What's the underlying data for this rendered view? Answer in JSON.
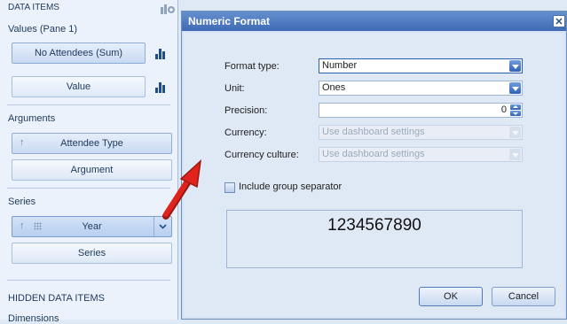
{
  "left_panel": {
    "header": "DATA ITEMS",
    "values_section": "Values (Pane 1)",
    "values_items": [
      "No Attendees (Sum)",
      "Value"
    ],
    "arguments_section": "Arguments",
    "arguments_items": [
      "Attendee Type",
      "Argument"
    ],
    "series_section": "Series",
    "series_items": [
      "Year",
      "Series"
    ],
    "hidden_section": "HIDDEN DATA ITEMS",
    "hidden_partial": "Dimensions"
  },
  "dialog": {
    "title": "Numeric Format",
    "close_glyph": "✕",
    "fields": {
      "format_type": {
        "label": "Format type:",
        "value": "Number"
      },
      "unit": {
        "label": "Unit:",
        "value": "Ones"
      },
      "precision": {
        "label": "Precision:",
        "value": "0"
      },
      "currency": {
        "label": "Currency:",
        "value": "Use dashboard settings"
      },
      "currency_culture": {
        "label": "Currency culture:",
        "value": "Use dashboard settings"
      }
    },
    "group_separator_label": "Include group separator",
    "group_separator_checked": false,
    "preview_value": "1234567890",
    "ok_label": "OK",
    "cancel_label": "Cancel"
  },
  "colors": {
    "titlebar": "#3f6ab4",
    "annotation_arrow": "#e0231b"
  }
}
